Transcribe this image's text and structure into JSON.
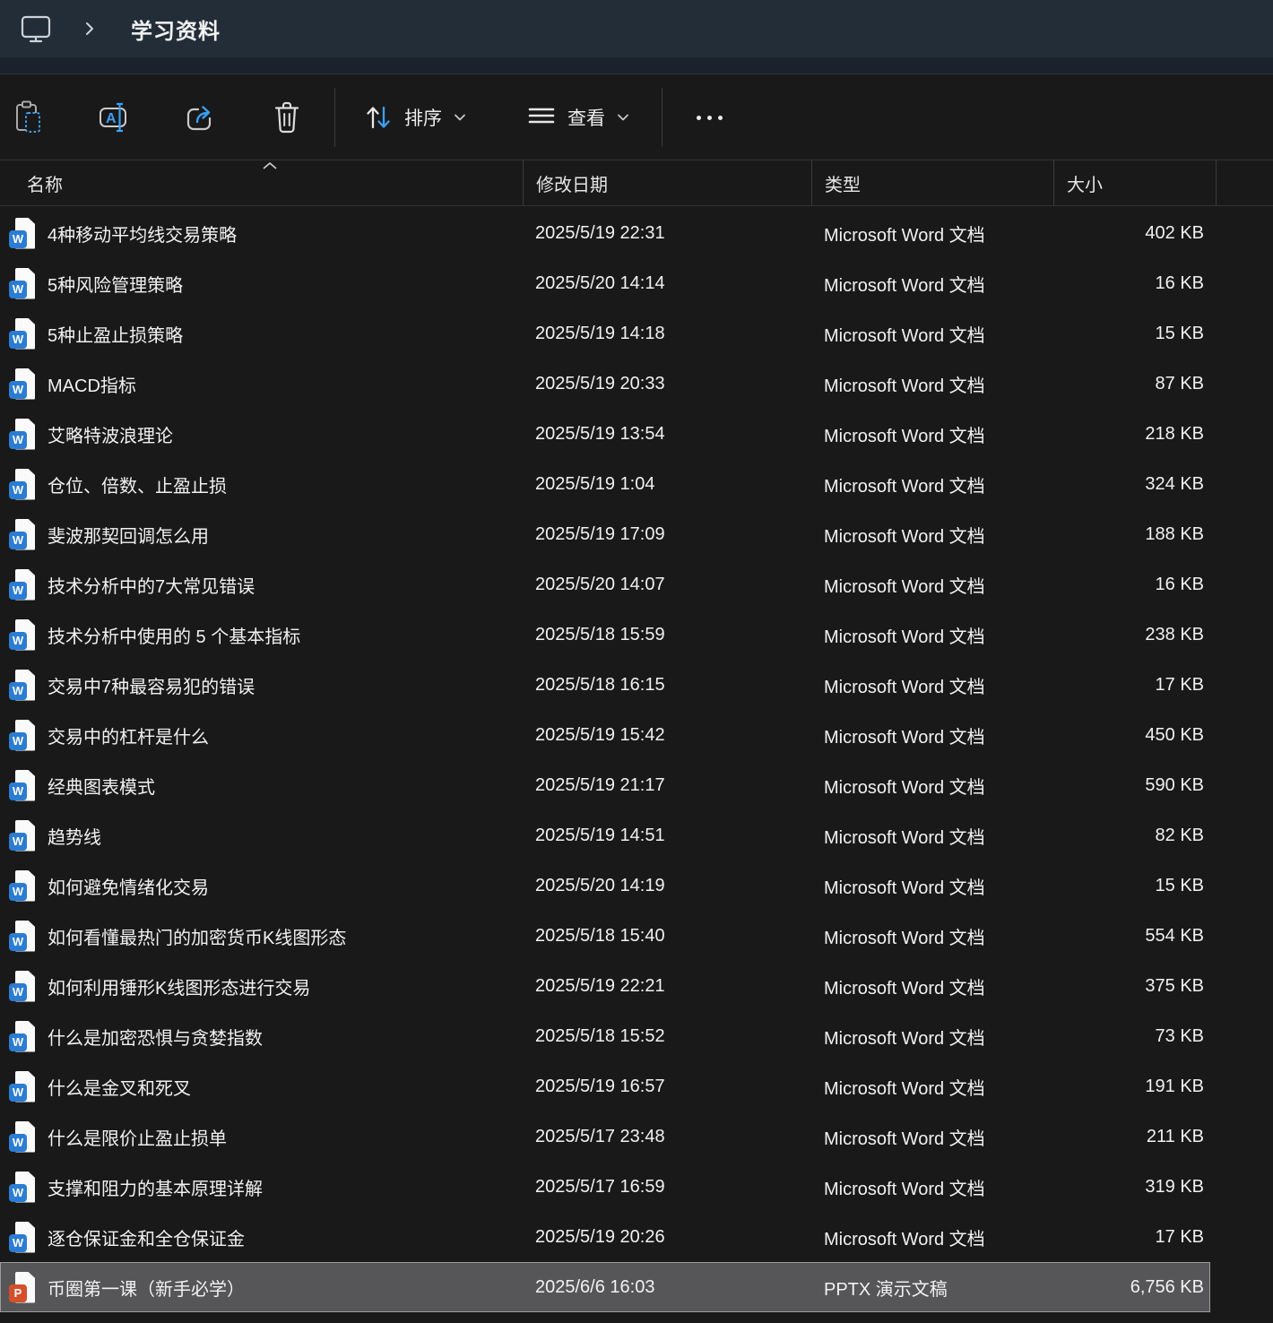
{
  "breadcrumb": {
    "title": "学习资料"
  },
  "toolbar": {
    "sort_label": "排序",
    "view_label": "查看",
    "more_label": "..."
  },
  "header": {
    "name": "名称",
    "date": "修改日期",
    "type": "类型",
    "size": "大小",
    "sort_direction": "ascending"
  },
  "colors": {
    "accent_blue": "#3ba0f3",
    "selection_bg": "#565659",
    "topbar_bg": "#232d38"
  },
  "file_kinds": {
    "word": {
      "letter": "W",
      "color": "#2b7cd3",
      "icon_name": "word-file-icon"
    },
    "ppt": {
      "letter": "P",
      "color": "#d4502a",
      "icon_name": "powerpoint-file-icon"
    }
  },
  "files": [
    {
      "name": "4种移动平均线交易策略",
      "date": "2025/5/19 22:31",
      "type": "Microsoft Word 文档",
      "size": "402 KB",
      "kind": "word",
      "selected": false
    },
    {
      "name": "5种风险管理策略",
      "date": "2025/5/20 14:14",
      "type": "Microsoft Word 文档",
      "size": "16 KB",
      "kind": "word",
      "selected": false
    },
    {
      "name": "5种止盈止损策略",
      "date": "2025/5/19 14:18",
      "type": "Microsoft Word 文档",
      "size": "15 KB",
      "kind": "word",
      "selected": false
    },
    {
      "name": "MACD指标",
      "date": "2025/5/19 20:33",
      "type": "Microsoft Word 文档",
      "size": "87 KB",
      "kind": "word",
      "selected": false
    },
    {
      "name": "艾略特波浪理论",
      "date": "2025/5/19 13:54",
      "type": "Microsoft Word 文档",
      "size": "218 KB",
      "kind": "word",
      "selected": false
    },
    {
      "name": "仓位、倍数、止盈止损",
      "date": "2025/5/19 1:04",
      "type": "Microsoft Word 文档",
      "size": "324 KB",
      "kind": "word",
      "selected": false
    },
    {
      "name": "斐波那契回调怎么用",
      "date": "2025/5/19 17:09",
      "type": "Microsoft Word 文档",
      "size": "188 KB",
      "kind": "word",
      "selected": false
    },
    {
      "name": "技术分析中的7大常见错误",
      "date": "2025/5/20 14:07",
      "type": "Microsoft Word 文档",
      "size": "16 KB",
      "kind": "word",
      "selected": false
    },
    {
      "name": "技术分析中使用的 5 个基本指标",
      "date": "2025/5/18 15:59",
      "type": "Microsoft Word 文档",
      "size": "238 KB",
      "kind": "word",
      "selected": false
    },
    {
      "name": "交易中7种最容易犯的错误",
      "date": "2025/5/18 16:15",
      "type": "Microsoft Word 文档",
      "size": "17 KB",
      "kind": "word",
      "selected": false
    },
    {
      "name": "交易中的杠杆是什么",
      "date": "2025/5/19 15:42",
      "type": "Microsoft Word 文档",
      "size": "450 KB",
      "kind": "word",
      "selected": false
    },
    {
      "name": "经典图表模式",
      "date": "2025/5/19 21:17",
      "type": "Microsoft Word 文档",
      "size": "590 KB",
      "kind": "word",
      "selected": false
    },
    {
      "name": "趋势线",
      "date": "2025/5/19 14:51",
      "type": "Microsoft Word 文档",
      "size": "82 KB",
      "kind": "word",
      "selected": false
    },
    {
      "name": "如何避免情绪化交易",
      "date": "2025/5/20 14:19",
      "type": "Microsoft Word 文档",
      "size": "15 KB",
      "kind": "word",
      "selected": false
    },
    {
      "name": "如何看懂最热门的加密货币K线图形态",
      "date": "2025/5/18 15:40",
      "type": "Microsoft Word 文档",
      "size": "554 KB",
      "kind": "word",
      "selected": false
    },
    {
      "name": "如何利用锤形K线图形态进行交易",
      "date": "2025/5/19 22:21",
      "type": "Microsoft Word 文档",
      "size": "375 KB",
      "kind": "word",
      "selected": false
    },
    {
      "name": "什么是加密恐惧与贪婪指数",
      "date": "2025/5/18 15:52",
      "type": "Microsoft Word 文档",
      "size": "73 KB",
      "kind": "word",
      "selected": false
    },
    {
      "name": "什么是金叉和死叉",
      "date": "2025/5/19 16:57",
      "type": "Microsoft Word 文档",
      "size": "191 KB",
      "kind": "word",
      "selected": false
    },
    {
      "name": "什么是限价止盈止损单",
      "date": "2025/5/17 23:48",
      "type": "Microsoft Word 文档",
      "size": "211 KB",
      "kind": "word",
      "selected": false
    },
    {
      "name": "支撑和阻力的基本原理详解",
      "date": "2025/5/17 16:59",
      "type": "Microsoft Word 文档",
      "size": "319 KB",
      "kind": "word",
      "selected": false
    },
    {
      "name": "逐仓保证金和全仓保证金",
      "date": "2025/5/19 20:26",
      "type": "Microsoft Word 文档",
      "size": "17 KB",
      "kind": "word",
      "selected": false
    },
    {
      "name": "币圈第一课（新手必学）",
      "date": "2025/6/6 16:03",
      "type": "PPTX 演示文稿",
      "size": "6,756 KB",
      "kind": "ppt",
      "selected": true
    }
  ]
}
